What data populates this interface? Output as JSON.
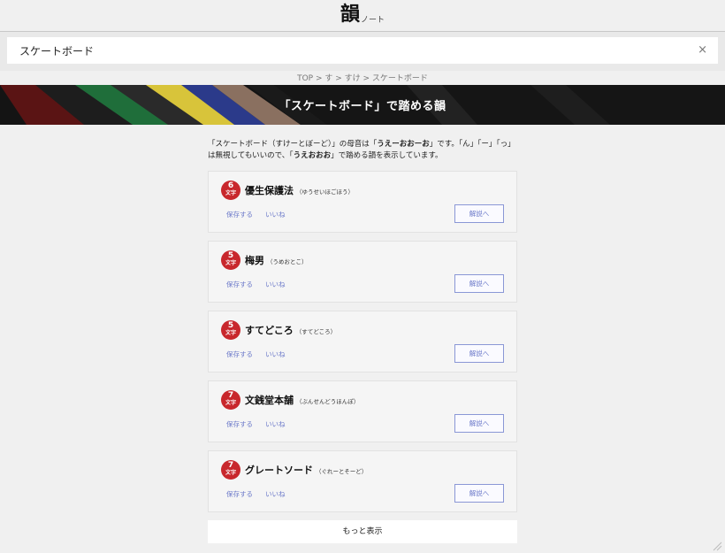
{
  "header": {
    "logo_main": "韻",
    "logo_sub": "ノート"
  },
  "search": {
    "value": "スケートボード",
    "clear_glyph": "×"
  },
  "breadcrumb": "TOP > す > すけ > スケートボード",
  "hero": {
    "title": "「スケートボード」で踏める韻"
  },
  "intro": {
    "p1": "「スケートボード（すけーとぼーど）」の母音は「",
    "vowels": "うえーおおーお",
    "p2": "」です。「ん」「ー」「っ」は無視してもいいので、「",
    "vowels2": "うえおおお",
    "p3": "」で踏める韻を表示しています。"
  },
  "results": [
    {
      "count": "6",
      "unit": "文字",
      "word": "優生保護法",
      "reading": "（ゆうせいほごほう）",
      "save": "保存する",
      "like": "いいね",
      "detail": "解説へ"
    },
    {
      "count": "5",
      "unit": "文字",
      "word": "梅男",
      "reading": "（うめおとこ）",
      "save": "保存する",
      "like": "いいね",
      "detail": "解説へ"
    },
    {
      "count": "5",
      "unit": "文字",
      "word": "すてどころ",
      "reading": "（すてどころ）",
      "save": "保存する",
      "like": "いいね",
      "detail": "解説へ"
    },
    {
      "count": "7",
      "unit": "文字",
      "word": "文銭堂本舗",
      "reading": "（ぶんせんどうほんぽ）",
      "save": "保存する",
      "like": "いいね",
      "detail": "解説へ"
    },
    {
      "count": "7",
      "unit": "文字",
      "word": "グレートソード",
      "reading": "（ぐれーとそーど）",
      "save": "保存する",
      "like": "いいね",
      "detail": "解説へ"
    }
  ],
  "more": "もっと表示",
  "colors": {
    "badge": "#c8272c",
    "link": "#6a78c9",
    "button_border": "#8a97d6"
  }
}
